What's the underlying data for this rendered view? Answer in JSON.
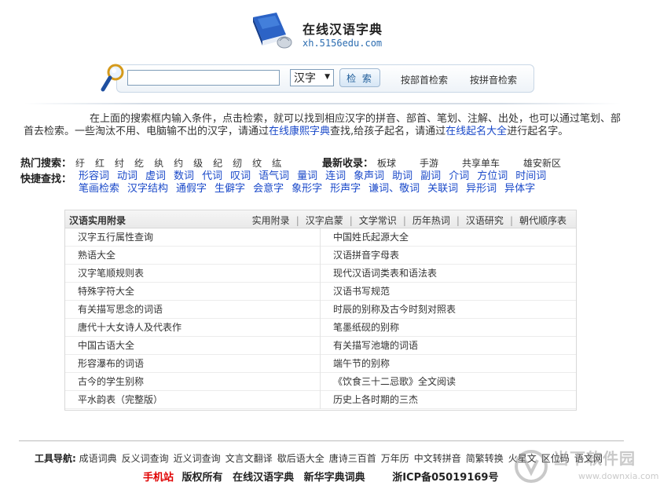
{
  "header": {
    "title": "在线汉语字典",
    "url": "xh.5156edu.com"
  },
  "search": {
    "input_value": "",
    "type_selected": "汉字",
    "button_label": "检 索",
    "radical_link": "按部首检索",
    "pinyin_link": "按拼音检索"
  },
  "intro": {
    "text1": "在上面的搜索框内输入条件，点击检索，就可以找到相应汉字的拼音、部首、笔划、注解、出处，也可以通过笔划、部首去检索。一些淘汰不用、电脑输不出的汉字，请通过",
    "link1": "在线康熙字典",
    "text2": "查找,给孩子起名，请通过",
    "link2": "在线起名大全",
    "text3": "进行起名字。"
  },
  "hot": {
    "label": "热门搜索：",
    "chars": [
      "纡",
      "红",
      "纣",
      "纥",
      "纨",
      "约",
      "级",
      "纪",
      "纫",
      "纹",
      "纮"
    ]
  },
  "recent": {
    "label": "最新收录：",
    "items": [
      "板球",
      "手游",
      "共享单车",
      "雄安新区"
    ]
  },
  "quick": {
    "label": "快捷查找：",
    "links": [
      "形容词",
      "动词",
      "虚词",
      "数词",
      "代词",
      "叹词",
      "语气词",
      "量词",
      "连词",
      "象声词",
      "助词",
      "副词",
      "介词",
      "方位词",
      "时间词",
      "笔画检索",
      "汉字结构",
      "通假字",
      "生僻字",
      "会意字",
      "象形字",
      "形声字",
      "谦词、敬词",
      "关联词",
      "异形词",
      "异体字"
    ]
  },
  "appendix": {
    "title": "汉语实用附录",
    "tabs": [
      "实用附录",
      "汉字启蒙",
      "文学常识",
      "历年热词",
      "汉语研究",
      "朝代顺序表"
    ],
    "left": [
      "汉字五行属性查询",
      "熟语大全",
      "汉字笔顺规则表",
      "特殊字符大全",
      "有关描写思念的词语",
      "唐代十大女诗人及代表作",
      "中国古语大全",
      "形容瀑布的词语",
      "古今的学生别称",
      "平水韵表（完整版）"
    ],
    "right": [
      "中国姓氏起源大全",
      "汉语拼音字母表",
      "现代汉语词类表和语法表",
      "汉语书写规范",
      "时辰的别称及古今时刻对照表",
      "笔墨纸砚的别称",
      "有关描写池塘的词语",
      "端午节的别称",
      "《饮食三十二忌歌》全文阅读",
      "历史上各时期的三杰"
    ]
  },
  "footer": {
    "tools_label": "工具导航:",
    "tools": [
      "成语词典",
      "反义词查询",
      "近义词查询",
      "文言文翻译",
      "歇后语大全",
      "唐诗三百首",
      "万年历",
      "中文转拼音",
      "简繁转换",
      "火星文",
      "区位码",
      "语文网"
    ],
    "mobile": "手机站",
    "copyright": "版权所有",
    "site_name": "在线汉语字典",
    "site_name2": "新华字典词典",
    "icp": "浙ICP备05019169号"
  },
  "watermark": {
    "text": "当下软件园",
    "url": "www.downxia.com"
  },
  "colors": {
    "link_blue": "#1a49c9",
    "mobile_red": "#e00000",
    "book_blue": "#1e50a8"
  }
}
